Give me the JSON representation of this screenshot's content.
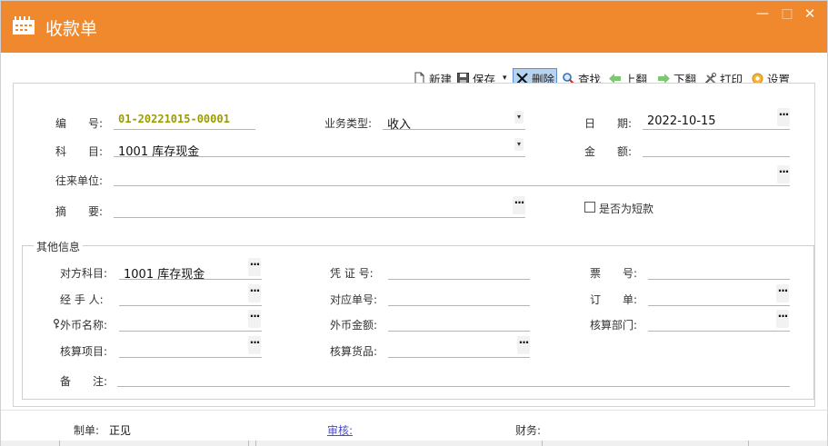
{
  "window": {
    "title": "收款单",
    "minimize_symbol": "—",
    "maximize_symbol": "□",
    "close_symbol": "✕",
    "accent_color": "#f0892e"
  },
  "toolbar": {
    "new_label": "新建",
    "save_label": "保存",
    "save_dropdown_symbol": "▾",
    "delete_label": "删除",
    "find_label": "查找",
    "prev_label": "上翻",
    "next_label": "下翻",
    "print_label": "打印",
    "settings_label": "设置"
  },
  "form": {
    "number_label": "编　　号:",
    "number_value": "01-20221015-00001",
    "business_type_label": "业务类型:",
    "business_type_value": "收入",
    "date_label": "日　　期:",
    "date_value": "2022-10-15",
    "subject_label": "科　　目:",
    "subject_value": "1001 库存现金",
    "amount_label": "金　　额:",
    "amount_value": "",
    "partner_label": "往来单位:",
    "partner_value": "",
    "summary_label": "摘　　要:",
    "summary_value": "",
    "short_label": "是否为短款",
    "short_checked": false,
    "dropdown_symbol": "▾",
    "ellipsis_symbol": "···"
  },
  "other": {
    "group_title": "其他信息",
    "counter_subject_label": "对方科目:",
    "counter_subject_value": "1001 库存现金",
    "voucher_label": "凭 证 号:",
    "ticket_label": "票　　号:",
    "handler_label": "经 手 人:",
    "order_no_label": "对应单号:",
    "order_label": "订　　单:",
    "currency_label": "外币名称:",
    "currency_amount_label": "外币金额:",
    "dept_label": "核算部门:",
    "project_label": "核算项目:",
    "goods_label": "核算货品:",
    "remark_label": "备　　注:"
  },
  "footer": {
    "maker_label": "制单:",
    "maker_value": "正见",
    "audit_label": "审核:",
    "finance_label": "财务:"
  }
}
